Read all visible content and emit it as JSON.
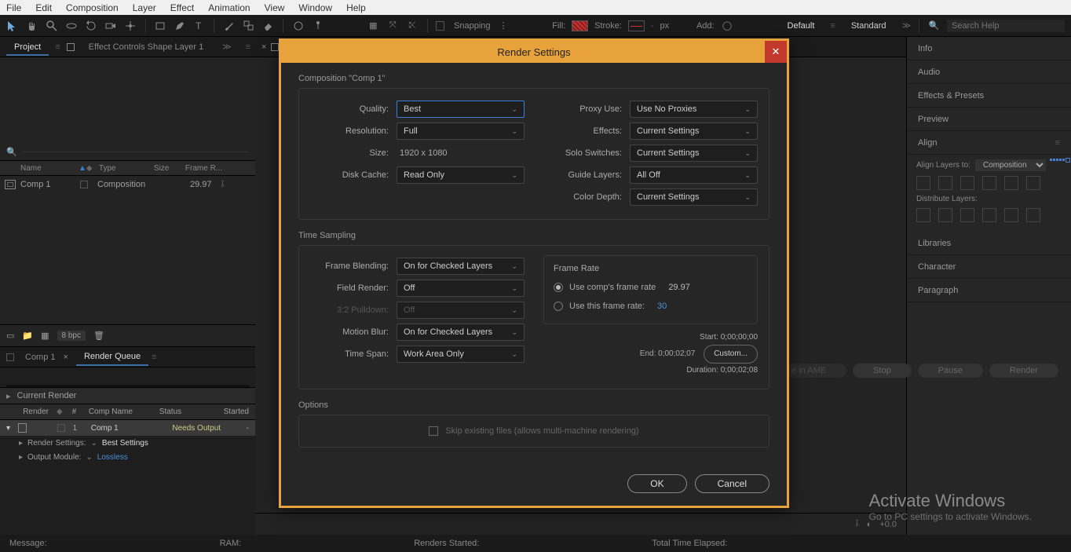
{
  "menu": [
    "File",
    "Edit",
    "Composition",
    "Layer",
    "Effect",
    "Animation",
    "View",
    "Window",
    "Help"
  ],
  "toolbar": {
    "snapping": "Snapping",
    "fill": "Fill:",
    "stroke": "Stroke:",
    "px": "px",
    "add": "Add:",
    "ws_default": "Default",
    "ws_standard": "Standard",
    "search_ph": "Search Help"
  },
  "left": {
    "project_tab": "Project",
    "fx_tab": "Effect Controls Shape Layer 1",
    "cols": {
      "name": "Name",
      "type": "Type",
      "size": "Size",
      "fr": "Frame R..."
    },
    "item": {
      "name": "Comp 1",
      "type": "Composition",
      "fr": "29.97"
    },
    "bpc": "8 bpc"
  },
  "timeline": {
    "comp_tab": "Comp 1",
    "rq_tab": "Render Queue",
    "current_render": "Current Render",
    "cols": {
      "render": "Render",
      "num": "#",
      "comp": "Comp Name",
      "status": "Status",
      "started": "Started"
    },
    "row": {
      "num": "1",
      "comp": "Comp 1",
      "status": "Needs Output",
      "started": "-"
    },
    "rs_label": "Render Settings:",
    "rs_val": "Best Settings",
    "om_label": "Output Module:",
    "om_val": "Lossless",
    "btn_ame": "Queue in AME",
    "btn_stop": "Stop",
    "btn_pause": "Pause",
    "btn_render": "Render"
  },
  "right": {
    "items": [
      "Info",
      "Audio",
      "Effects & Presets",
      "Preview"
    ],
    "align": "Align",
    "align_to": "Align Layers to:",
    "align_sel": "Composition",
    "dist": "Distribute Layers:",
    "libs": "Libraries",
    "char": "Character",
    "para": "Paragraph"
  },
  "status": {
    "msg": "Message:",
    "ram": "RAM:",
    "rs": "Renders Started:",
    "tte": "Total Time Elapsed:"
  },
  "watermark": {
    "t1": "Activate Windows",
    "t2": "Go to PC settings to activate Windows."
  },
  "center_footer": "+0.0",
  "modal": {
    "title": "Render Settings",
    "comp_head": "Composition \"Comp 1\"",
    "quality_l": "Quality:",
    "quality_v": "Best",
    "res_l": "Resolution:",
    "res_v": "Full",
    "size_l": "Size:",
    "size_v": "1920 x 1080",
    "disk_l": "Disk Cache:",
    "disk_v": "Read Only",
    "proxy_l": "Proxy Use:",
    "proxy_v": "Use No Proxies",
    "fx_l": "Effects:",
    "fx_v": "Current Settings",
    "solo_l": "Solo Switches:",
    "solo_v": "Current Settings",
    "guide_l": "Guide Layers:",
    "guide_v": "All Off",
    "depth_l": "Color Depth:",
    "depth_v": "Current Settings",
    "ts_head": "Time Sampling",
    "fb_l": "Frame Blending:",
    "fb_v": "On for Checked Layers",
    "fr_l": "Field Render:",
    "fr_v": "Off",
    "pd_l": "3:2 Pulldown:",
    "pd_v": "Off",
    "mb_l": "Motion Blur:",
    "mb_v": "On for Checked Layers",
    "span_l": "Time Span:",
    "span_v": "Work Area Only",
    "frate_head": "Frame Rate",
    "frate_comp": "Use comp's frame rate",
    "frate_comp_v": "29.97",
    "frate_this": "Use this frame rate:",
    "frate_this_v": "30",
    "start_l": "Start:",
    "start_v": "0;00;00;00",
    "end_l": "End:",
    "end_v": "0;00;02;07",
    "dur_l": "Duration:",
    "dur_v": "0;00;02;08",
    "custom": "Custom...",
    "opt_head": "Options",
    "skip": "Skip existing files (allows multi-machine rendering)",
    "ok": "OK",
    "cancel": "Cancel"
  }
}
